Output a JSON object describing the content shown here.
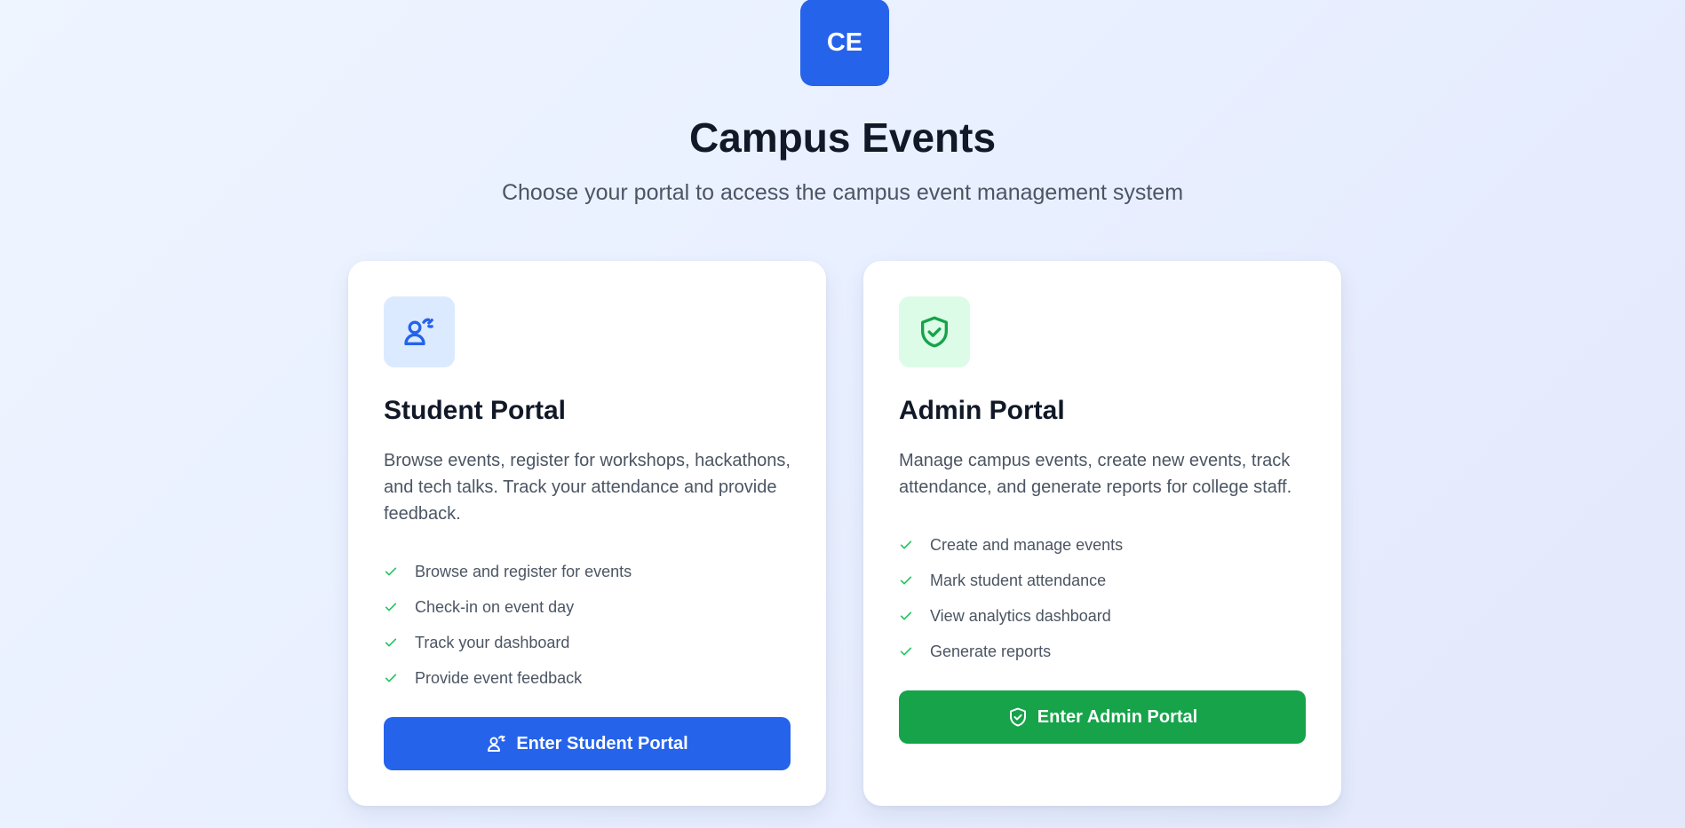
{
  "logo": {
    "text": "CE"
  },
  "header": {
    "title": "Campus Events",
    "subtitle": "Choose your portal to access the campus event management system"
  },
  "colors": {
    "primary_blue": "#2563eb",
    "primary_green": "#16a34a",
    "check_green": "#22c55e",
    "title_text": "#111827",
    "body_text": "#4b5563"
  },
  "student_portal": {
    "icon": "user-graduate-icon",
    "title": "Student Portal",
    "description": "Browse events, register for workshops, hackathons, and tech talks. Track your attendance and provide feedback.",
    "features": [
      "Browse and register for events",
      "Check-in on event day",
      "Track your dashboard",
      "Provide event feedback"
    ],
    "button_label": "Enter Student Portal",
    "button_icon": "user-graduate-icon"
  },
  "admin_portal": {
    "icon": "shield-check-icon",
    "title": "Admin Portal",
    "description": "Manage campus events, create new events, track attendance, and generate reports for college staff.",
    "features": [
      "Create and manage events",
      "Mark student attendance",
      "View analytics dashboard",
      "Generate reports"
    ],
    "button_label": "Enter Admin Portal",
    "button_icon": "shield-check-icon"
  }
}
